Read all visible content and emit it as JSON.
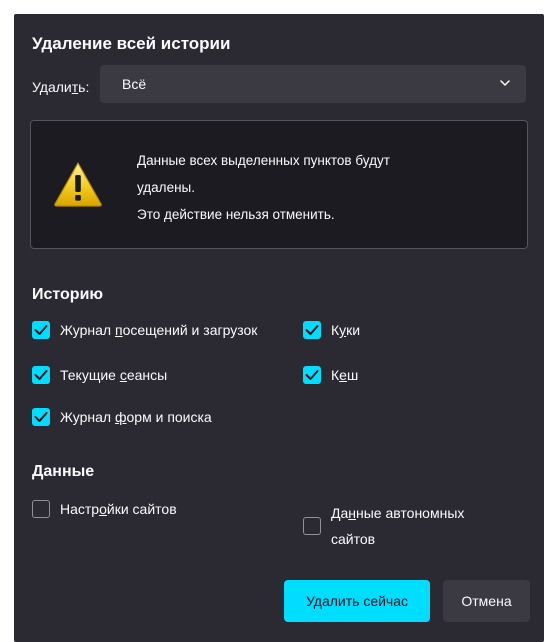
{
  "dialog": {
    "title": "Удаление всей истории",
    "range_label_pre": "Удали",
    "range_label_u": "т",
    "range_label_post": "ь:",
    "range_value": "Всё",
    "warning_line1": "Данные всех выделенных пунктов будут",
    "warning_line2": "удалены.",
    "warning_line3": "Это действие нельзя отменить."
  },
  "history": {
    "heading": "Историю",
    "items": [
      {
        "pre": "Журнал ",
        "u": "п",
        "post": "осещений и загрузок",
        "checked": true
      },
      {
        "pre": "К",
        "u": "у",
        "post": "ки",
        "checked": true
      },
      {
        "pre": "Текущие ",
        "u": "с",
        "post": "еансы",
        "checked": true
      },
      {
        "pre": "К",
        "u": "е",
        "post": "ш",
        "checked": true
      },
      {
        "pre": "Журнал ",
        "u": "ф",
        "post": "орм и поиска",
        "checked": true
      }
    ]
  },
  "data": {
    "heading": "Данные",
    "items": [
      {
        "pre": "Настр",
        "u": "о",
        "post": "йки сайтов",
        "checked": false
      },
      {
        "pre": "Да",
        "u": "н",
        "post": "ные автономных",
        "line2": "сайтов",
        "checked": false
      }
    ]
  },
  "buttons": {
    "clear_now": "Удалить сейчас",
    "cancel": "Отмена"
  },
  "colors": {
    "accent": "#00ddff",
    "background": "#2b2a33",
    "warning_bg": "#1c1b22",
    "warning_icon": "#f5c518"
  },
  "icons": {
    "dropdown": "chevron-down-icon",
    "warning": "warning-icon",
    "check": "check-icon"
  }
}
